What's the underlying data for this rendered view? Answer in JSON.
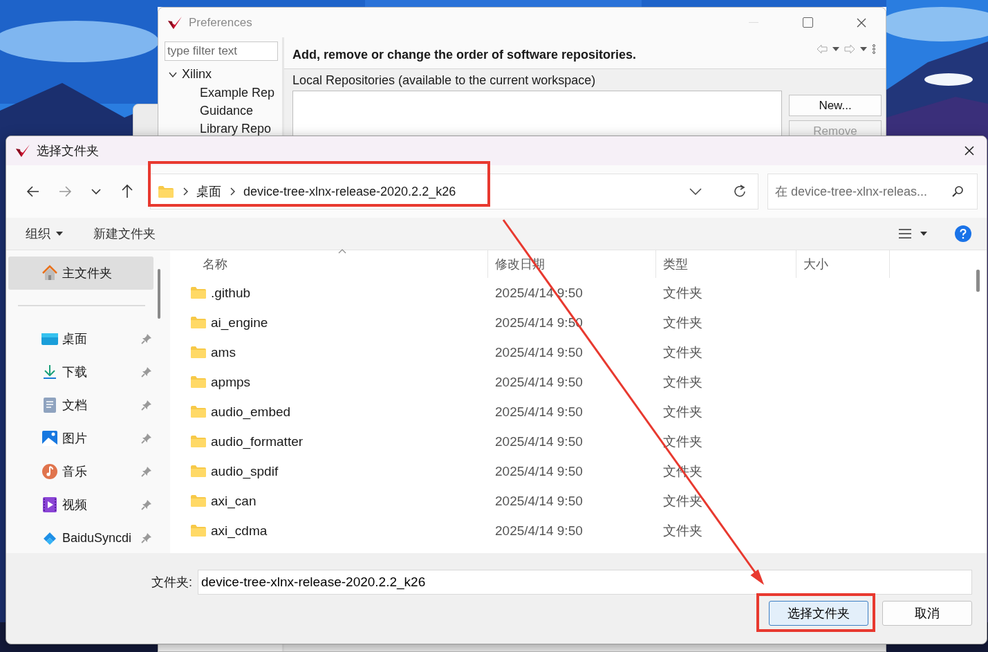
{
  "preferences": {
    "title": "Preferences",
    "filter": {
      "placeholder": "type filter text"
    },
    "tree": [
      {
        "label": "Xilinx",
        "expanded": true,
        "children": [
          {
            "label": "Example Rep"
          },
          {
            "label": "Guidance"
          },
          {
            "label": "Library Repo"
          }
        ]
      }
    ],
    "heading": "Add, remove or change the order of software repositories.",
    "section_label": "Local Repositories (available to the current workspace)",
    "buttons": [
      {
        "label": "New...",
        "disabled": false
      },
      {
        "label": "Remove",
        "disabled": true
      }
    ]
  },
  "dialog": {
    "title": "选择文件夹",
    "address_bar": {
      "path": [
        "桌面",
        "device-tree-xlnx-release-2020.2.2_k26"
      ],
      "highlighted": true
    },
    "search": {
      "placeholder": "在 device-tree-xlnx-releas..."
    },
    "toolbar": [
      {
        "label": "组织",
        "kind": "menu"
      },
      {
        "label": "新建文件夹",
        "kind": "button"
      }
    ],
    "sidebar": {
      "items": [
        {
          "label": "主文件夹",
          "kind": "home",
          "selected": true,
          "pinned": false
        },
        {
          "label": "桌面",
          "kind": "desktop",
          "selected": false,
          "pinned": true
        },
        {
          "label": "下载",
          "kind": "download",
          "selected": false,
          "pinned": true
        },
        {
          "label": "文档",
          "kind": "documents",
          "selected": false,
          "pinned": true
        },
        {
          "label": "图片",
          "kind": "pictures",
          "selected": false,
          "pinned": true
        },
        {
          "label": "音乐",
          "kind": "music",
          "selected": false,
          "pinned": true
        },
        {
          "label": "视频",
          "kind": "videos",
          "selected": false,
          "pinned": true
        },
        {
          "label": "BaiduSyncdi",
          "kind": "cloud",
          "selected": false,
          "pinned": true
        }
      ]
    },
    "table": {
      "columns": [
        {
          "label": "名称",
          "sorted": true
        },
        {
          "label": "修改日期",
          "sorted": false
        },
        {
          "label": "类型",
          "sorted": false
        },
        {
          "label": "大小",
          "sorted": false
        }
      ],
      "rows": [
        {
          "name": ".github",
          "modified": "2025/4/14 9:50",
          "type": "文件夹"
        },
        {
          "name": "ai_engine",
          "modified": "2025/4/14 9:50",
          "type": "文件夹"
        },
        {
          "name": "ams",
          "modified": "2025/4/14 9:50",
          "type": "文件夹"
        },
        {
          "name": "apmps",
          "modified": "2025/4/14 9:50",
          "type": "文件夹"
        },
        {
          "name": "audio_embed",
          "modified": "2025/4/14 9:50",
          "type": "文件夹"
        },
        {
          "name": "audio_formatter",
          "modified": "2025/4/14 9:50",
          "type": "文件夹"
        },
        {
          "name": "audio_spdif",
          "modified": "2025/4/14 9:50",
          "type": "文件夹"
        },
        {
          "name": "axi_can",
          "modified": "2025/4/14 9:50",
          "type": "文件夹"
        },
        {
          "name": "axi_cdma",
          "modified": "2025/4/14 9:50",
          "type": "文件夹"
        }
      ]
    },
    "folder_field": {
      "label": "文件夹:",
      "value": "device-tree-xlnx-release-2020.2.2_k26"
    },
    "buttons": [
      {
        "label": "选择文件夹",
        "default": true,
        "highlighted": true
      },
      {
        "label": "取消",
        "default": false,
        "highlighted": false
      }
    ],
    "annotation_arrow": true
  }
}
